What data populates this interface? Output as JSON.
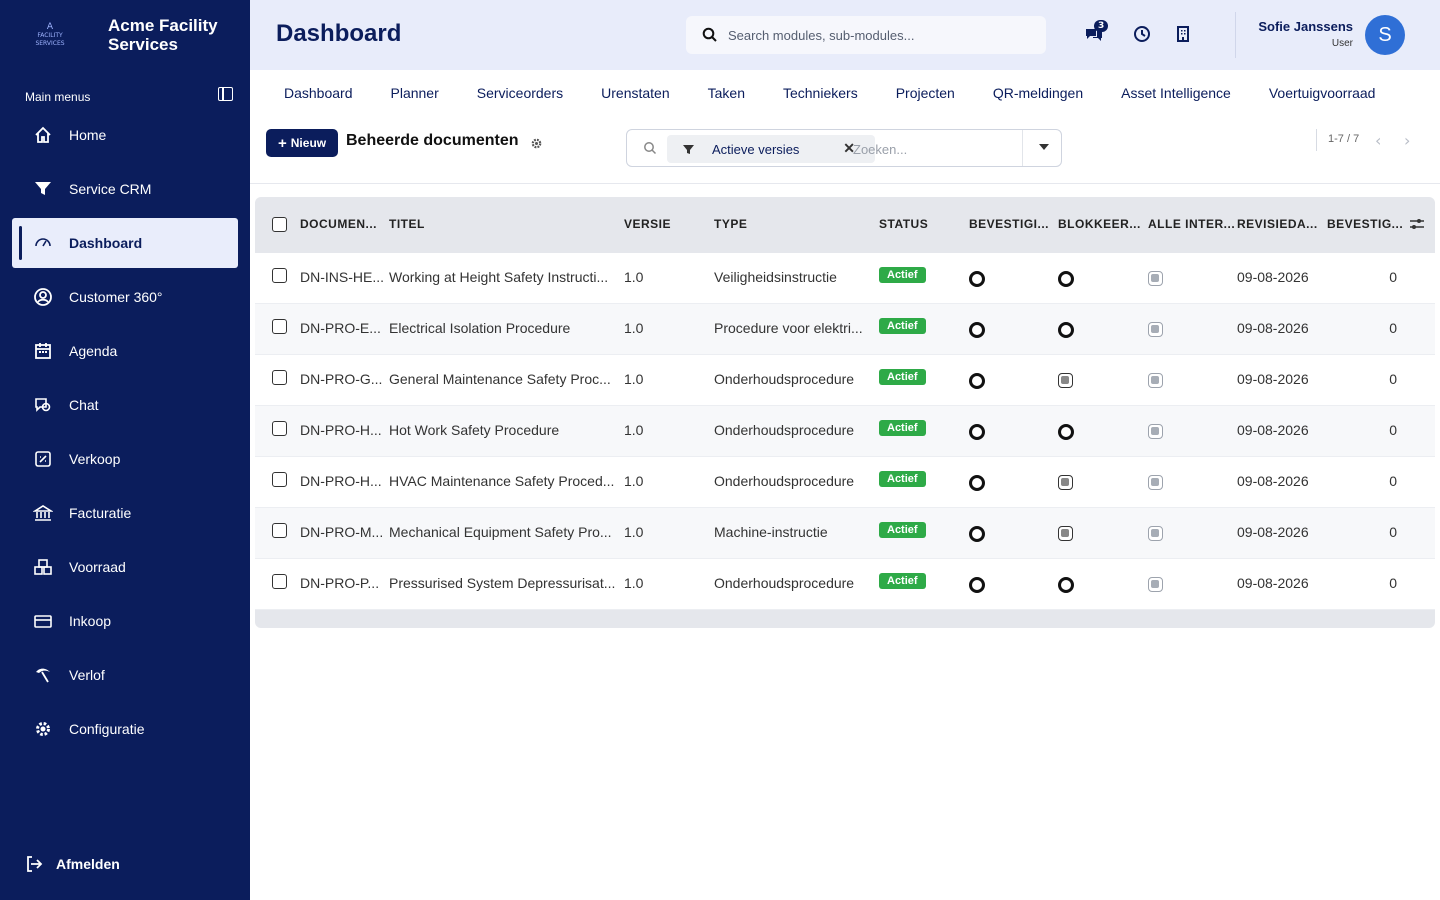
{
  "brand": {
    "logo_small": "A",
    "logo_caption": "FACILITY SERVICES",
    "name_line1": "Acme Facility",
    "name_line2": "Services"
  },
  "sidebar": {
    "header": "Main menus",
    "items": [
      {
        "label": "Home",
        "icon": "home-icon"
      },
      {
        "label": "Service CRM",
        "icon": "filter-icon"
      },
      {
        "label": "Dashboard",
        "icon": "gauge-icon",
        "active": true
      },
      {
        "label": "Customer 360°",
        "icon": "user-circle-icon"
      },
      {
        "label": "Agenda",
        "icon": "calendar-icon"
      },
      {
        "label": "Chat",
        "icon": "chat-icon"
      },
      {
        "label": "Verkoop",
        "icon": "sales-icon"
      },
      {
        "label": "Facturatie",
        "icon": "bank-icon"
      },
      {
        "label": "Voorraad",
        "icon": "warehouse-icon"
      },
      {
        "label": "Inkoop",
        "icon": "card-icon"
      },
      {
        "label": "Verlof",
        "icon": "leave-icon"
      },
      {
        "label": "Configuratie",
        "icon": "gear-icon"
      }
    ],
    "logout": "Afmelden"
  },
  "header": {
    "title": "Dashboard",
    "search_placeholder": "Search modules, sub-modules...",
    "chat_badge": "3",
    "user_name": "Sofie Janssens",
    "user_role": "User",
    "avatar_letter": "S"
  },
  "tabs": [
    "Dashboard",
    "Planner",
    "Serviceorders",
    "Urenstaten",
    "Taken",
    "Techniekers",
    "Projecten",
    "QR-meldingen",
    "Asset Intelligence",
    "Voertuigvoorraad"
  ],
  "toolbar": {
    "new_label": "Nieuw",
    "section_title": "Beheerde documenten",
    "filter_chip": "Actieve versies",
    "filter_placeholder": "Zoeken...",
    "pager": "1-7 / 7"
  },
  "table": {
    "columns": [
      "DOCUMEN...",
      "TITEL",
      "VERSIE",
      "TYPE",
      "STATUS",
      "BEVESTIGI...",
      "BLOKKEER...",
      "ALLE INTER...",
      "REVISIEDA...",
      "BEVESTIG..."
    ],
    "rows": [
      {
        "doc": "DN-INS-HE...",
        "titel": "Working at Height Safety Instructi...",
        "versie": "1.0",
        "type": "Veiligheidsinstructie",
        "status": "Actief",
        "block_grey": false,
        "revisie": "09-08-2026",
        "bevestig": "0"
      },
      {
        "doc": "DN-PRO-E...",
        "titel": "Electrical Isolation Procedure",
        "versie": "1.0",
        "type": "Procedure voor elektri...",
        "status": "Actief",
        "block_grey": false,
        "revisie": "09-08-2026",
        "bevestig": "0"
      },
      {
        "doc": "DN-PRO-G...",
        "titel": "General Maintenance Safety Proc...",
        "versie": "1.0",
        "type": "Onderhoudsprocedure",
        "status": "Actief",
        "block_grey": true,
        "revisie": "09-08-2026",
        "bevestig": "0"
      },
      {
        "doc": "DN-PRO-H...",
        "titel": "Hot Work Safety Procedure",
        "versie": "1.0",
        "type": "Onderhoudsprocedure",
        "status": "Actief",
        "block_grey": false,
        "revisie": "09-08-2026",
        "bevestig": "0"
      },
      {
        "doc": "DN-PRO-H...",
        "titel": "HVAC Maintenance Safety Proced...",
        "versie": "1.0",
        "type": "Onderhoudsprocedure",
        "status": "Actief",
        "block_grey": true,
        "revisie": "09-08-2026",
        "bevestig": "0"
      },
      {
        "doc": "DN-PRO-M...",
        "titel": "Mechanical Equipment Safety Pro...",
        "versie": "1.0",
        "type": "Machine-instructie",
        "status": "Actief",
        "block_grey": true,
        "revisie": "09-08-2026",
        "bevestig": "0"
      },
      {
        "doc": "DN-PRO-P...",
        "titel": "Pressurised System Depressurisat...",
        "versie": "1.0",
        "type": "Onderhoudsprocedure",
        "status": "Actief",
        "block_grey": false,
        "revisie": "09-08-2026",
        "bevestig": "0"
      }
    ]
  },
  "colors": {
    "sidebar": "#0b1d5c",
    "accent": "#0b1d5c",
    "status_active": "#2eaa47",
    "avatar": "#2f6fd6"
  }
}
